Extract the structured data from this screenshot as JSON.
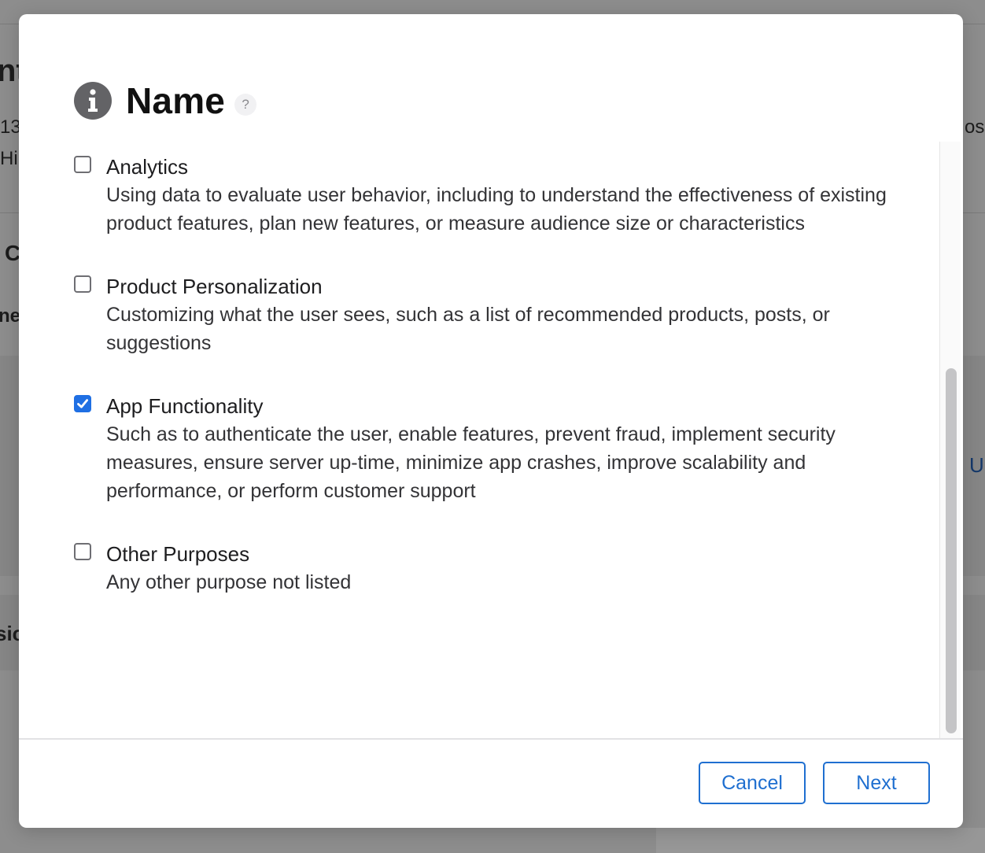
{
  "background_fragments": [
    "nt",
    "13",
    "Hi",
    "C",
    "ne",
    "sic",
    "os",
    "U"
  ],
  "dialog": {
    "title": "Name",
    "help_glyph": "?",
    "options": [
      {
        "title": "Analytics",
        "description": "Using data to evaluate user behavior, including to understand the effectiveness of existing product features, plan new features, or measure audience size or characteristics",
        "checked": false
      },
      {
        "title": "Product Personalization",
        "description": "Customizing what the user sees, such as a list of recommended products, posts, or suggestions",
        "checked": false
      },
      {
        "title": "App Functionality",
        "description": "Such as to authenticate the user, enable features, prevent fraud, implement security measures, ensure server up-time, minimize app crashes, improve scalability and performance, or perform customer support",
        "checked": true
      },
      {
        "title": "Other Purposes",
        "description": "Any other purpose not listed",
        "checked": false
      }
    ],
    "buttons": {
      "cancel": "Cancel",
      "next": "Next"
    }
  },
  "colors": {
    "accent": "#1f6fd0",
    "checkbox_checked": "#1f6fe3",
    "overlay": "#8d8d8d",
    "info_icon": "#636366"
  },
  "icons": {
    "header": "info-icon",
    "help": "help-icon",
    "check": "checkmark-icon"
  }
}
